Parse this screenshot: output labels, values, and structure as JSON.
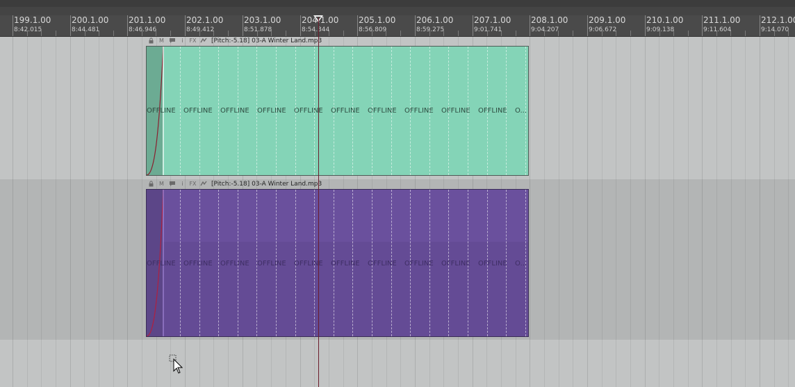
{
  "ruler": {
    "bars": [
      {
        "bar": "199.1.00",
        "time": "8:42.015"
      },
      {
        "bar": "200.1.00",
        "time": "8:44.481"
      },
      {
        "bar": "201.1.00",
        "time": "8:46.946"
      },
      {
        "bar": "202.1.00",
        "time": "8:49.412"
      },
      {
        "bar": "203.1.00",
        "time": "8:51.878"
      },
      {
        "bar": "204.1.00",
        "time": "8:54.344"
      },
      {
        "bar": "205.1.00",
        "time": "8:56.809"
      },
      {
        "bar": "206.1.00",
        "time": "8:59.275"
      },
      {
        "bar": "207.1.00",
        "time": "9:01.741"
      },
      {
        "bar": "208.1.00",
        "time": "9:04.207"
      },
      {
        "bar": "209.1.00",
        "time": "9:06.672"
      },
      {
        "bar": "210.1.00",
        "time": "9:09.138"
      },
      {
        "bar": "211.1.00",
        "time": "9:11.604"
      },
      {
        "bar": "212.1.00",
        "time": "9:14.070"
      }
    ]
  },
  "items": [
    {
      "name": "[Pitch:-5.18] 03-A Winter Land.mp3",
      "color": "#84d4b7",
      "offline": [
        "OFFLINE",
        "OFFLINE",
        "OFFLINE",
        "OFFLINE",
        "OFFLINE",
        "OFFLINE",
        "OFFLINE",
        "OFFLINE",
        "OFFLINE",
        "OFFLINE",
        "O..."
      ]
    },
    {
      "name": "[Pitch:-5.18] 03-A Winter Land.mp3",
      "color": "#6a509d",
      "offline": [
        "OFFLINE",
        "OFFLINE",
        "OFFLINE",
        "OFFLINE",
        "OFFLINE",
        "OFFLINE",
        "OFFLINE",
        "OFFLINE",
        "OFFLINE",
        "OFFLINE",
        "O..."
      ]
    }
  ],
  "item_buttons": {
    "lock": "lock-icon",
    "mute": "M",
    "notes": "notes-icon",
    "info": "i",
    "fx": "FX",
    "env": "envelope-icon"
  },
  "colors": {
    "playcursor": "#6b1d2c",
    "ruler_bg": "#4a4a4a"
  }
}
